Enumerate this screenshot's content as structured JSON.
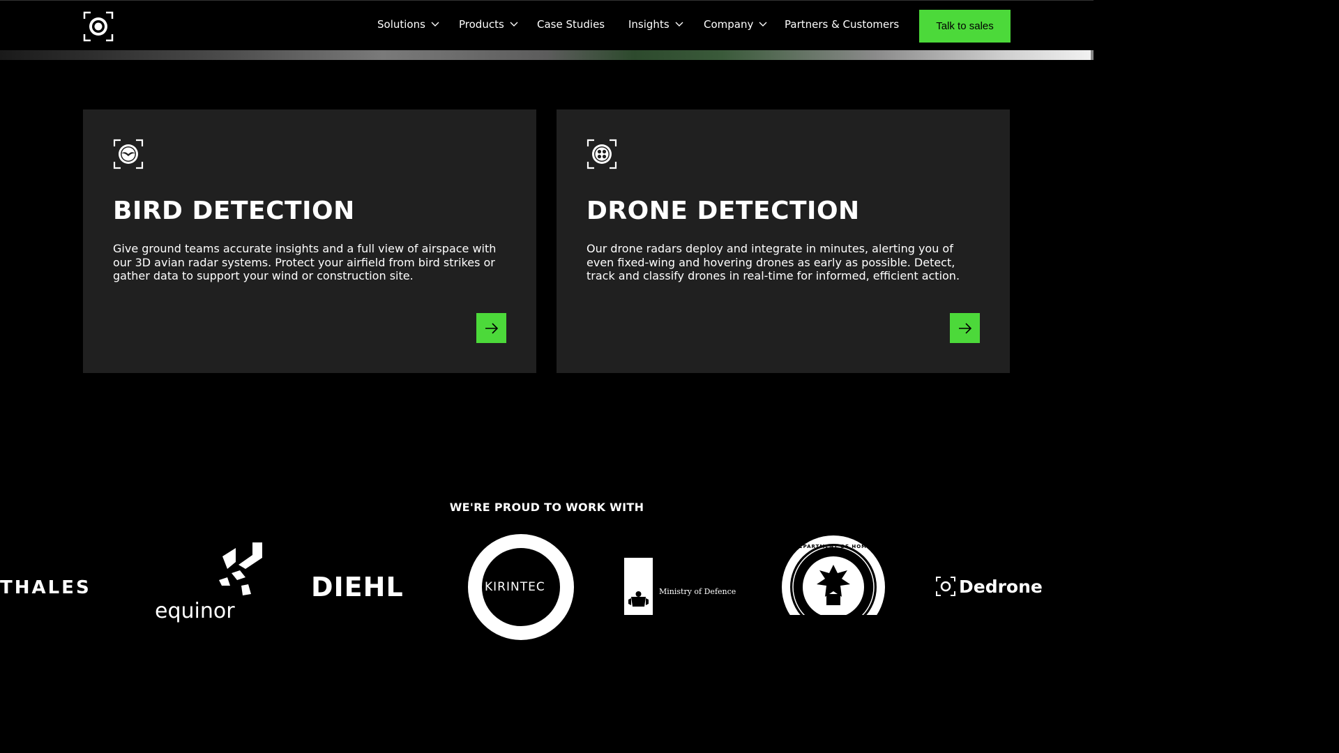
{
  "nav": {
    "items": [
      {
        "label": "Solutions",
        "dropdown": true
      },
      {
        "label": "Products",
        "dropdown": true
      },
      {
        "label": "Case Studies",
        "dropdown": false
      },
      {
        "label": "Insights",
        "dropdown": true
      },
      {
        "label": "Company",
        "dropdown": true
      },
      {
        "label": "Partners & Customers",
        "dropdown": false
      }
    ],
    "cta_label": "Talk to sales"
  },
  "cards": [
    {
      "icon": "bird-icon",
      "title": "BIRD DETECTION",
      "text": "Give ground teams accurate insights and a full view of airspace with our 3D avian radar systems. Protect your airfield from bird strikes or gather data to support your wind or construction site."
    },
    {
      "icon": "drone-icon",
      "title": "DRONE DETECTION",
      "text": "Our drone radars deploy and integrate in minutes, alerting you of even fixed-wing and hovering drones as early as possible. Detect, track and classify drones in real-time for informed, efficient action."
    }
  ],
  "partners": {
    "title": "WE'RE PROUD TO WORK WITH",
    "logos": [
      "THALES",
      "equinor",
      "DIEHL",
      "KIRINTEC",
      "Ministry of Defence",
      "DEPARTMENT OF HOMELAND SECURITY",
      "Dedrone"
    ]
  },
  "colors": {
    "accent": "#4cd93a",
    "card_bg": "#202020",
    "page_bg": "#000000"
  }
}
